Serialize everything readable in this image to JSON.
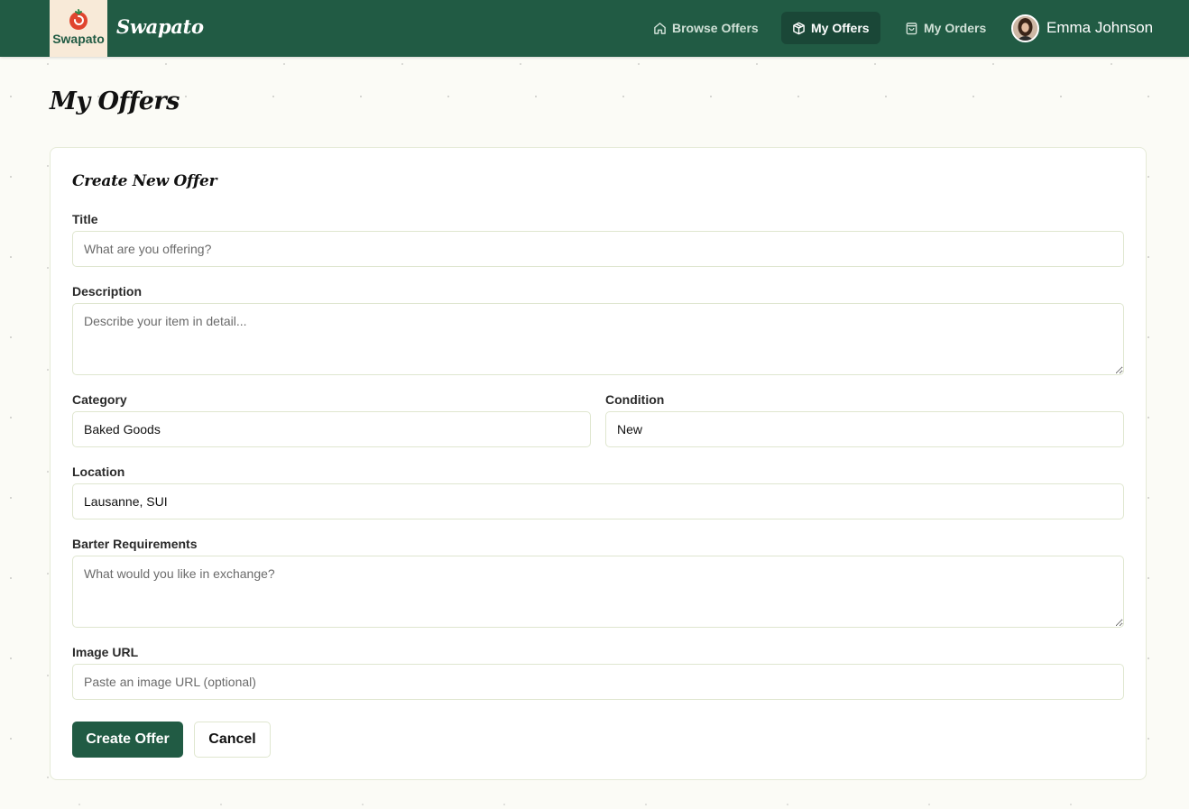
{
  "brand": {
    "logo_text": "Swapato",
    "name": "Swapato"
  },
  "nav": {
    "items": [
      {
        "label": "Browse Offers",
        "icon": "home-icon"
      },
      {
        "label": "My Offers",
        "icon": "box-icon",
        "active": true
      },
      {
        "label": "My Orders",
        "icon": "shopping-bag-icon"
      }
    ],
    "user_name": "Emma Johnson"
  },
  "page": {
    "title": "My Offers"
  },
  "form": {
    "heading": "Create New Offer",
    "title": {
      "label": "Title",
      "value": "",
      "placeholder": "What are you offering?"
    },
    "description": {
      "label": "Description",
      "value": "",
      "placeholder": "Describe your item in detail..."
    },
    "category": {
      "label": "Category",
      "value": "Baked Goods"
    },
    "condition": {
      "label": "Condition",
      "value": "New"
    },
    "location": {
      "label": "Location",
      "value": "Lausanne, SUI"
    },
    "barter": {
      "label": "Barter Requirements",
      "value": "",
      "placeholder": "What would you like in exchange?"
    },
    "image_url": {
      "label": "Image URL",
      "value": "",
      "placeholder": "Paste an image URL (optional)"
    },
    "submit_label": "Create Offer",
    "cancel_label": "Cancel"
  },
  "colors": {
    "primary": "#215b44",
    "background": "#fbfbf6",
    "logo_bg": "#f8ead8",
    "tomato": "#e0452f"
  }
}
